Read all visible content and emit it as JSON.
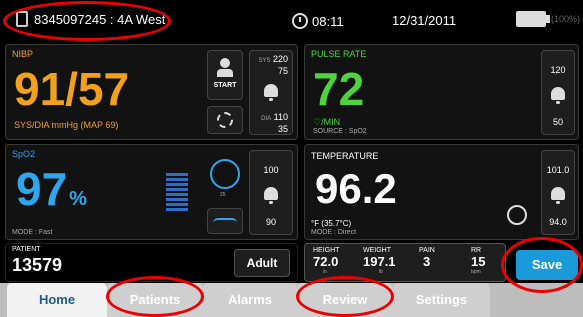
{
  "header": {
    "network_id": "8345097245 : 4A West",
    "time": "08:11",
    "date": "12/31/2011",
    "battery_pct": "(100%)"
  },
  "nibp": {
    "label": "NIBP",
    "value": "91/57",
    "units": "SYS/DIA mmHg (MAP 69)",
    "start_label": "START",
    "sys_label": "SYS",
    "sys_high": "220",
    "sys_low": "75",
    "dia_label": "DIA",
    "dia_high": "110",
    "dia_low": "35"
  },
  "pulse": {
    "label": "PULSE RATE",
    "value": "72",
    "units": "♡/MIN",
    "source": "SOURCE : SpO2",
    "high": "120",
    "low": "50"
  },
  "spo2": {
    "label": "SpO2",
    "value": "97",
    "percent": "%",
    "mode": "MODE : Fast",
    "ring_label": "25",
    "high": "100",
    "low": "90"
  },
  "temperature": {
    "label": "TEMPERATURE",
    "value": "96.2",
    "units": "°F (35.7°C)",
    "mode": "MODE : Direct",
    "high": "101.0",
    "low": "94.0"
  },
  "patient": {
    "label": "PATIENT",
    "id": "13579",
    "type_button": "Adult"
  },
  "manual": {
    "height_label": "HEIGHT",
    "height_value": "72.0",
    "height_unit": "in",
    "weight_label": "WEIGHT",
    "weight_value": "197.1",
    "weight_unit": "lb",
    "pain_label": "PAIN",
    "pain_value": "3",
    "rr_label": "RR",
    "rr_value": "15",
    "rr_unit": "bpm"
  },
  "save_label": "Save",
  "tabs": [
    "Home",
    "Patients",
    "Alarms",
    "Review",
    "Settings"
  ],
  "colors": {
    "nibp": "#f2a11c",
    "pulse": "#4fd53c",
    "spo2": "#2ba8ef",
    "save": "#1a9ad8",
    "annotation_ring": "#e00000"
  }
}
